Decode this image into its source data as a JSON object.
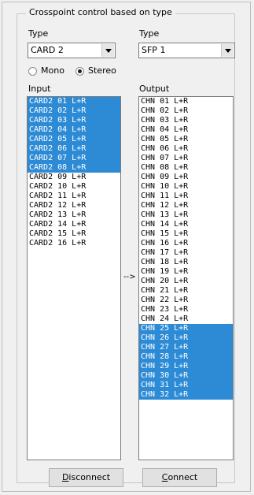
{
  "group": {
    "title": "Crosspoint control based on type"
  },
  "left": {
    "type_label": "Type",
    "type_value": "CARD 2",
    "list_label": "Input",
    "items": [
      {
        "label": "CARD2 01 L+R",
        "selected": true
      },
      {
        "label": "CARD2 02 L+R",
        "selected": true
      },
      {
        "label": "CARD2 03 L+R",
        "selected": true
      },
      {
        "label": "CARD2 04 L+R",
        "selected": true
      },
      {
        "label": "CARD2 05 L+R",
        "selected": true
      },
      {
        "label": "CARD2 06 L+R",
        "selected": true
      },
      {
        "label": "CARD2 07 L+R",
        "selected": true
      },
      {
        "label": "CARD2 08 L+R",
        "selected": true
      },
      {
        "label": "CARD2 09 L+R",
        "selected": false
      },
      {
        "label": "CARD2 10 L+R",
        "selected": false
      },
      {
        "label": "CARD2 11 L+R",
        "selected": false
      },
      {
        "label": "CARD2 12 L+R",
        "selected": false
      },
      {
        "label": "CARD2 13 L+R",
        "selected": false
      },
      {
        "label": "CARD2 14 L+R",
        "selected": false
      },
      {
        "label": "CARD2 15 L+R",
        "selected": false
      },
      {
        "label": "CARD2 16 L+R",
        "selected": false
      }
    ]
  },
  "right": {
    "type_label": "Type",
    "type_value": "SFP 1",
    "list_label": "Output",
    "items": [
      {
        "label": "CHN 01 L+R",
        "selected": false
      },
      {
        "label": "CHN 02 L+R",
        "selected": false
      },
      {
        "label": "CHN 03 L+R",
        "selected": false
      },
      {
        "label": "CHN 04 L+R",
        "selected": false
      },
      {
        "label": "CHN 05 L+R",
        "selected": false
      },
      {
        "label": "CHN 06 L+R",
        "selected": false
      },
      {
        "label": "CHN 07 L+R",
        "selected": false
      },
      {
        "label": "CHN 08 L+R",
        "selected": false
      },
      {
        "label": "CHN 09 L+R",
        "selected": false
      },
      {
        "label": "CHN 10 L+R",
        "selected": false
      },
      {
        "label": "CHN 11 L+R",
        "selected": false
      },
      {
        "label": "CHN 12 L+R",
        "selected": false
      },
      {
        "label": "CHN 13 L+R",
        "selected": false
      },
      {
        "label": "CHN 14 L+R",
        "selected": false
      },
      {
        "label": "CHN 15 L+R",
        "selected": false
      },
      {
        "label": "CHN 16 L+R",
        "selected": false
      },
      {
        "label": "CHN 17 L+R",
        "selected": false
      },
      {
        "label": "CHN 18 L+R",
        "selected": false
      },
      {
        "label": "CHN 19 L+R",
        "selected": false
      },
      {
        "label": "CHN 20 L+R",
        "selected": false
      },
      {
        "label": "CHN 21 L+R",
        "selected": false
      },
      {
        "label": "CHN 22 L+R",
        "selected": false
      },
      {
        "label": "CHN 23 L+R",
        "selected": false
      },
      {
        "label": "CHN 24 L+R",
        "selected": false
      },
      {
        "label": "CHN 25 L+R",
        "selected": true
      },
      {
        "label": "CHN 26 L+R",
        "selected": true
      },
      {
        "label": "CHN 27 L+R",
        "selected": true
      },
      {
        "label": "CHN 28 L+R",
        "selected": true
      },
      {
        "label": "CHN 29 L+R",
        "selected": true
      },
      {
        "label": "CHN 30 L+R",
        "selected": true
      },
      {
        "label": "CHN 31 L+R",
        "selected": true
      },
      {
        "label": "CHN 32 L+R",
        "selected": true
      }
    ]
  },
  "mode": {
    "mono_label": "Mono",
    "stereo_label": "Stereo",
    "selected": "stereo"
  },
  "arrow_label": "-->",
  "buttons": {
    "disconnect_label": "Disconnect",
    "connect_label": "Connect"
  },
  "colors": {
    "selection": "#2d8bd6",
    "background": "#f0f0f0"
  },
  "icons": {
    "combo_arrow": "chevron-down-icon"
  }
}
